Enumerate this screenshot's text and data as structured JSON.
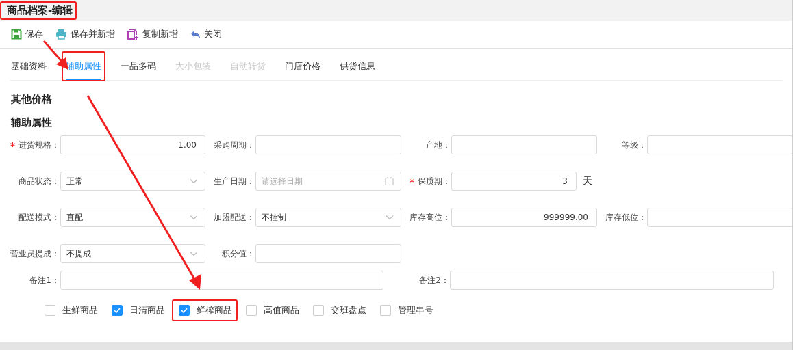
{
  "window": {
    "title": "商品档案-编辑",
    "highlighted": true
  },
  "toolbar": [
    {
      "label": "保存",
      "kind": "save"
    },
    {
      "label": "保存并新增",
      "kind": "print"
    },
    {
      "label": "复制新增",
      "kind": "copy"
    },
    {
      "label": "关闭",
      "kind": "close"
    }
  ],
  "tabs": [
    {
      "label": "基础资料",
      "selected": false,
      "disabled": false,
      "highlighted": false
    },
    {
      "label": "辅助属性",
      "selected": true,
      "disabled": false,
      "highlighted": true
    },
    {
      "label": "一品多码",
      "selected": false,
      "disabled": false,
      "highlighted": false
    },
    {
      "label": "大小包装",
      "selected": false,
      "disabled": true,
      "highlighted": false
    },
    {
      "label": "自动转货",
      "selected": false,
      "disabled": true,
      "highlighted": false
    },
    {
      "label": "门店价格",
      "selected": false,
      "disabled": false,
      "highlighted": false
    },
    {
      "label": "供货信息",
      "selected": false,
      "disabled": false,
      "highlighted": false
    }
  ],
  "sections": [
    "其他价格",
    "辅助属性"
  ],
  "form_rows": [
    [
      {
        "label": "进货规格：",
        "required": true,
        "kind": "number",
        "value": "1.00"
      },
      {
        "label": "采购周期：",
        "required": false,
        "kind": "text"
      },
      {
        "label": "产地：",
        "required": false,
        "kind": "text"
      },
      {
        "label": "等级：",
        "required": false,
        "kind": "text"
      }
    ],
    [
      {
        "label": "商品状态：",
        "required": false,
        "kind": "select",
        "value": "正常"
      },
      {
        "label": "生产日期：",
        "required": false,
        "kind": "date",
        "placeholder": "请选择日期"
      },
      {
        "label": "保质期：",
        "required": true,
        "kind": "number",
        "value": "3",
        "suffix": "天"
      }
    ],
    [
      {
        "label": "配送模式：",
        "required": false,
        "kind": "select",
        "value": "直配"
      },
      {
        "label": "加盟配送：",
        "required": false,
        "kind": "select",
        "value": "不控制"
      },
      {
        "label": "库存高位：",
        "required": false,
        "kind": "number",
        "value": "999999.00"
      },
      {
        "label": "库存低位：",
        "required": false,
        "kind": "text"
      }
    ],
    [
      {
        "label": "营业员提成：",
        "required": false,
        "kind": "select",
        "value": "不提成"
      },
      {
        "label": "积分值：",
        "required": false,
        "kind": "text"
      }
    ]
  ],
  "remarks": [
    {
      "label": "备注1："
    },
    {
      "label": "备注2："
    }
  ],
  "checkboxes": [
    {
      "label": "生鲜商品",
      "checked": false,
      "highlighted": false
    },
    {
      "label": "日清商品",
      "checked": true,
      "highlighted": false
    },
    {
      "label": "鲜榨商品",
      "checked": true,
      "highlighted": true
    },
    {
      "label": "高值商品",
      "checked": false,
      "highlighted": false
    },
    {
      "label": "交班盘点",
      "checked": false,
      "highlighted": false
    },
    {
      "label": "管理串号",
      "checked": false,
      "highlighted": false
    }
  ]
}
